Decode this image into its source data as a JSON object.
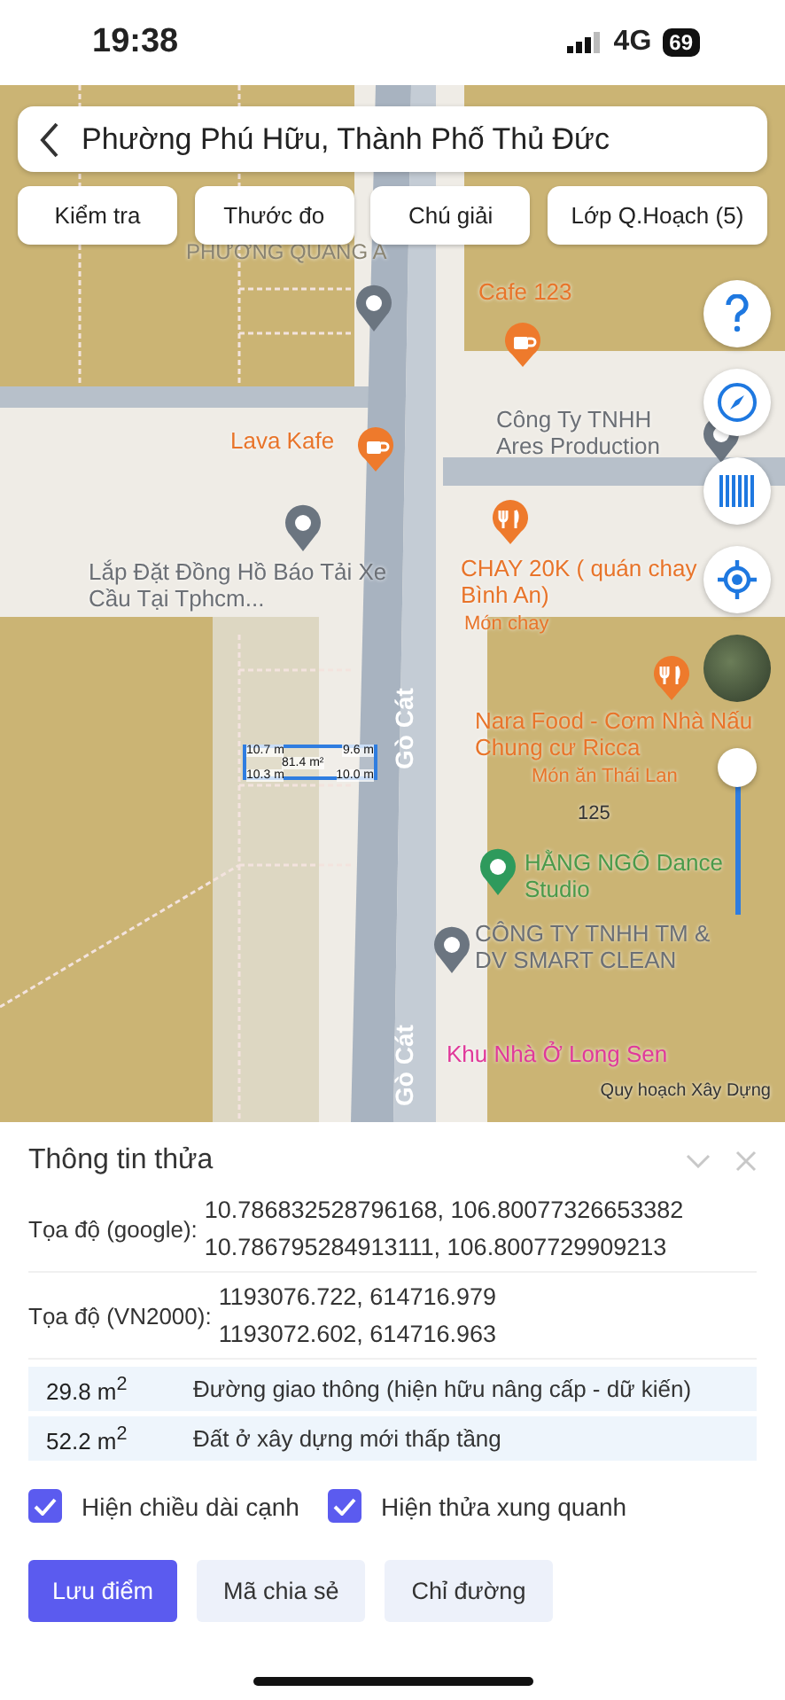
{
  "status_bar": {
    "time": "19:38",
    "network": "4G",
    "battery": "69"
  },
  "search": {
    "value": "Phường Phú Hữu, Thành Phố Thủ Đức"
  },
  "toolbar": [
    {
      "label": "Kiểm tra"
    },
    {
      "label": "Thước đo"
    },
    {
      "label": "Chú giải"
    },
    {
      "label": "Lớp Q.Hoạch (5)"
    }
  ],
  "map": {
    "labels": [
      {
        "text": "PHƯỜNG QUANG A",
        "kind": "area"
      },
      {
        "text": "Cafe 123",
        "kind": "food"
      },
      {
        "text": "Lava Kafe",
        "kind": "food"
      },
      {
        "text": "Công Ty TNHH Ares Production",
        "kind": "business"
      },
      {
        "text": "CHAY 20K ( quán chay Bình An)",
        "kind": "food"
      },
      {
        "text": "Món chay",
        "kind": "food_sub"
      },
      {
        "text": "Lắp Đặt Đồng Hồ Báo Tải Xe Cầu Tại Tphcm...",
        "kind": "business"
      },
      {
        "text": "Nara Food - Cơm Nhà Nấu Chung cư Ricca",
        "kind": "food"
      },
      {
        "text": "Món ăn Thái Lan",
        "kind": "food_sub"
      },
      {
        "text": "125",
        "kind": "parcel"
      },
      {
        "text": "HẰNG NGÔ Dance Studio",
        "kind": "dance"
      },
      {
        "text": "CÔNG TY TNHH TM & DV SMART CLEAN",
        "kind": "business"
      },
      {
        "text": "Khu Nhà Ở Long Sen",
        "kind": "housing"
      },
      {
        "text": "Gò Cát",
        "kind": "street"
      },
      {
        "text": "Gò Cát",
        "kind": "street"
      }
    ],
    "measure": {
      "top_left": "10.7 m",
      "top_right": "9.6 m",
      "area": "81.4 m²",
      "bottom_left": "10.3 m",
      "bottom_right": "10.0 m"
    },
    "attribution": "Quy hoạch Xây Dựng",
    "zoom_slider": {
      "level": 0.77
    }
  },
  "panel": {
    "title": "Thông tin thửa",
    "coords": [
      {
        "label": "Tọa độ (google):",
        "values": [
          "10.786832528796168, 106.80077326653382",
          "10.786795284913111, 106.8007729909213"
        ]
      },
      {
        "label": "Tọa độ (VN2000):",
        "values": [
          "1193076.722, 614716.979",
          "1193072.602, 614716.963"
        ]
      }
    ],
    "areas": [
      {
        "area": "29.8 m$^{2}$",
        "use": "Đường giao thông (hiện hữu nâng cấp - dữ kiến)"
      },
      {
        "area": "52.2 m$^{2}$",
        "use": "Đất ở xây dựng mới thấp tầng"
      }
    ],
    "options": [
      {
        "label": "Hiện chiều dài cạnh",
        "checked": true
      },
      {
        "label": "Hiện thửa xung quanh",
        "checked": true
      }
    ],
    "buttons": [
      {
        "label": "Lưu điểm",
        "kind": "primary"
      },
      {
        "label": "Mã chia sẻ",
        "kind": "secondary"
      },
      {
        "label": "Chỉ đường",
        "kind": "secondary"
      }
    ]
  }
}
